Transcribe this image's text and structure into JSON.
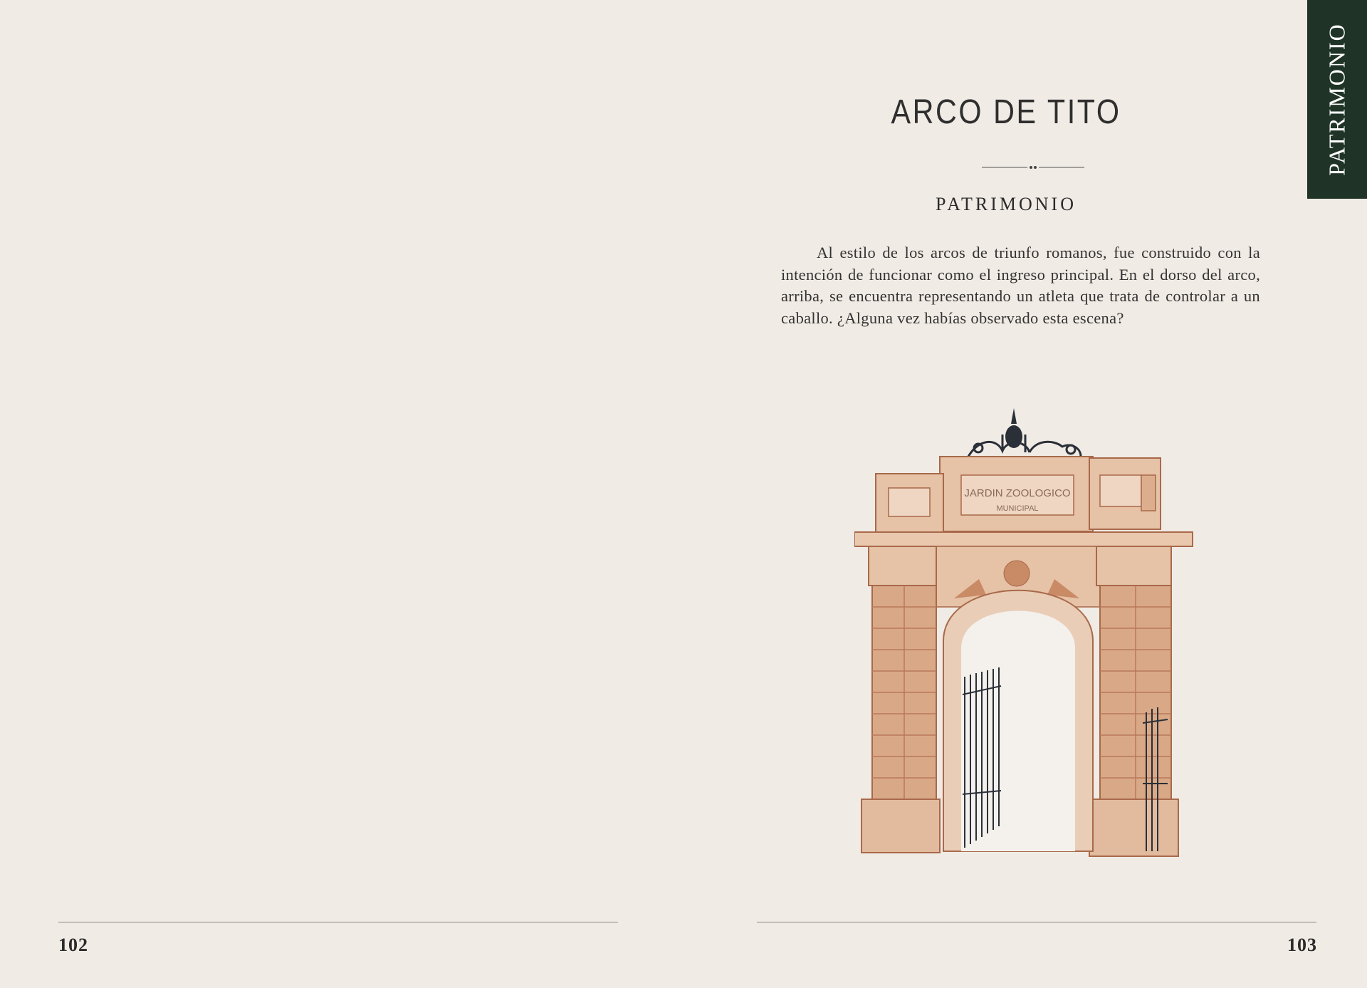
{
  "left_page": {
    "page_number": "102"
  },
  "right_page": {
    "side_tab_label": "PATRIMONIO",
    "title": "ARCO DE TITO",
    "subtitle": "PATRIMONIO",
    "body": "Al estilo de los arcos de triunfo romanos, fue construido con la intención de funcionar como el ingreso principal. En el dorso del arco, arriba, se encuentra representando un atleta que trata de controlar a un caballo. ¿Alguna vez habías observado esta escena?",
    "illustration": {
      "icon": "arch-illustration",
      "inscription_line1": "JARDIN ZOOLOGICO",
      "inscription_line2": "MUNICIPAL"
    },
    "page_number": "103"
  },
  "colors": {
    "paper": "#f0ebe4",
    "tab": "#1f3427",
    "stone": "#d9a987",
    "stone_dark": "#a8694a"
  }
}
